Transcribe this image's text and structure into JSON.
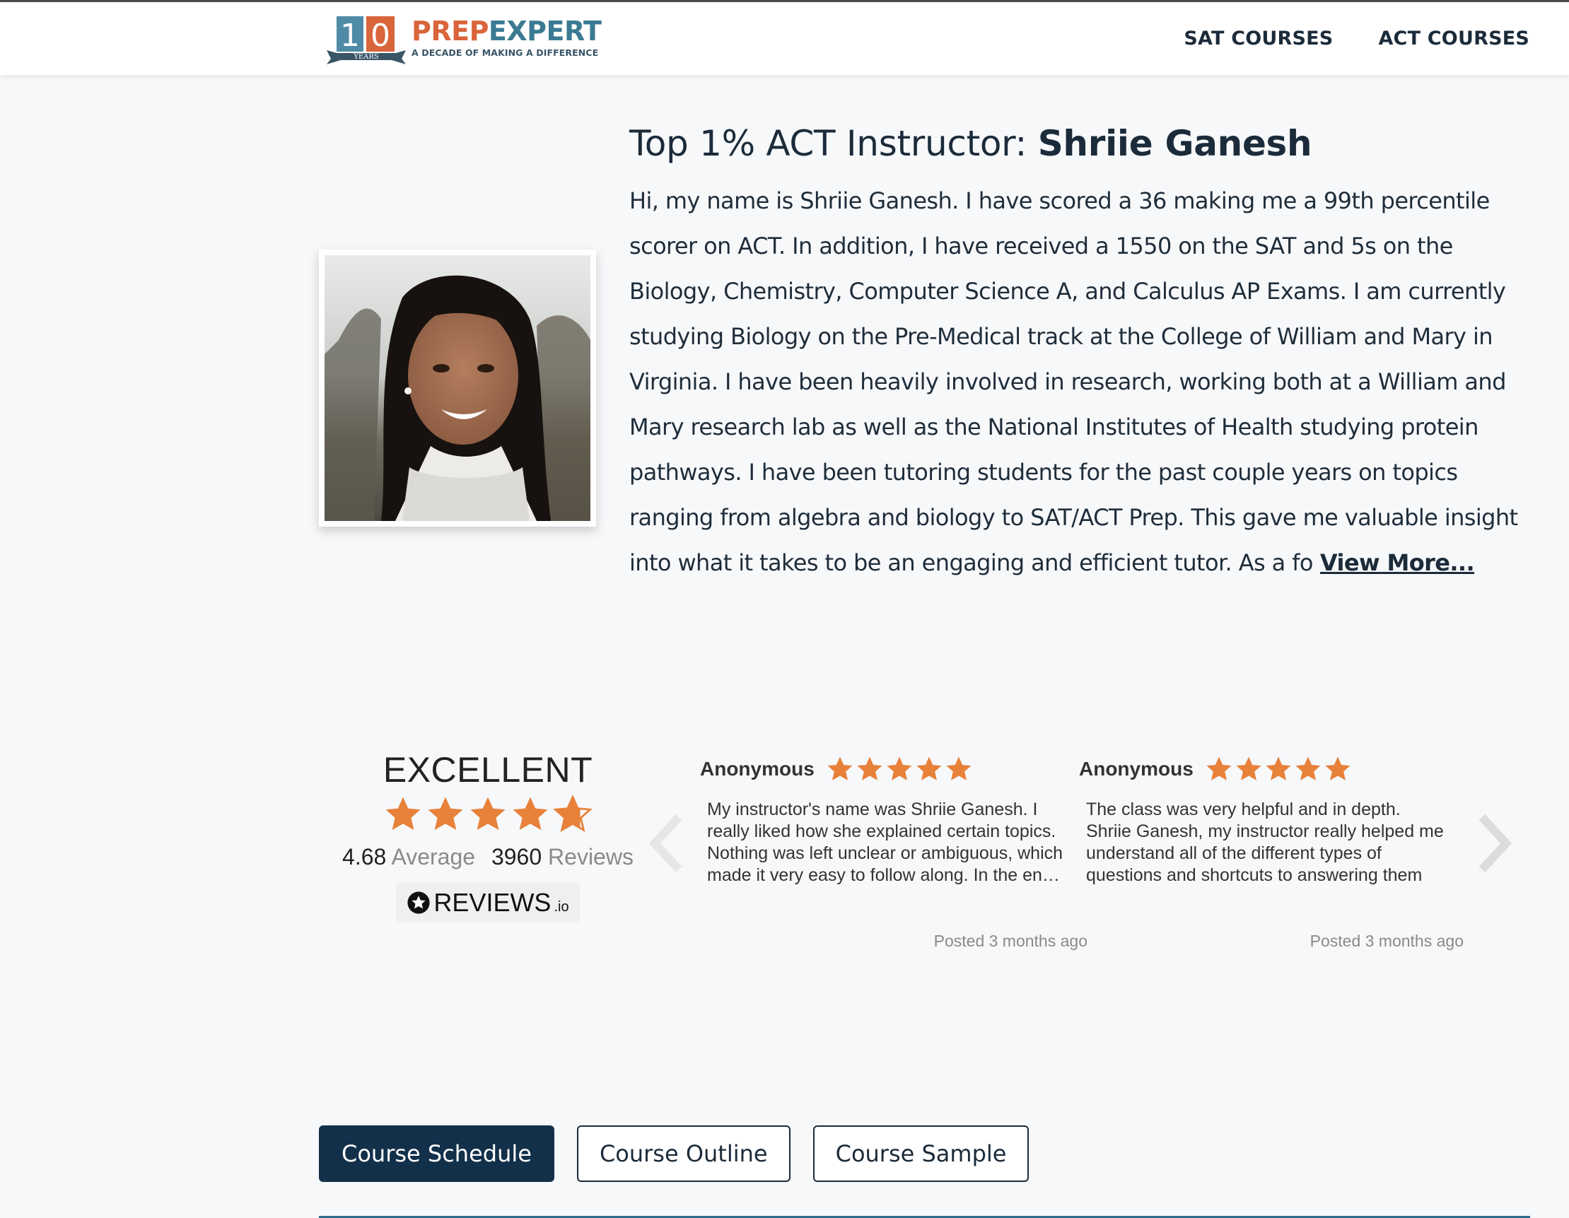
{
  "header": {
    "logo": {
      "badge_number": "10",
      "badge_label": "YEARS",
      "brand_prep": "PREP",
      "brand_expert": "EXPERT",
      "tagline": "A DECADE OF MAKING A DIFFERENCE"
    },
    "nav": [
      {
        "label": "SAT COURSES"
      },
      {
        "label": "ACT COURSES"
      }
    ]
  },
  "instructor": {
    "title_prefix": "Top 1% ACT Instructor: ",
    "name": "Shriie Ganesh",
    "bio": "Hi, my name is Shriie Ganesh. I have scored a 36 making me a 99th percentile scorer on ACT. In addition, I have received a 1550 on the SAT and 5s on the Biology, Chemistry, Computer Science A, and Calculus AP Exams. I am currently studying Biology on the Pre-Medical track at the College of William and Mary in Virginia. I have been heavily involved in research, working both at a William and Mary research lab as well as the National Institutes of Health studying protein pathways. I have been tutoring students for the past couple years on topics ranging from algebra and biology to SAT/ACT Prep. This gave me valuable insight into what it takes to be an engaging and efficient tutor. As a fo",
    "view_more": "View More..."
  },
  "reviews_widget": {
    "rating_word": "EXCELLENT",
    "average": "4.68",
    "average_label": "Average",
    "review_count": "3960",
    "reviews_label": "Reviews",
    "star_rating": 4.68,
    "provider": "REVIEWS",
    "provider_suffix": ".io",
    "star_color": "#e8813a",
    "reviews": [
      {
        "author": "Anonymous",
        "stars": 5,
        "text": "My instructor's name was Shriie Ganesh. I really liked how she explained certain topics. Nothing was left unclear or ambiguous, which made it very easy to follow along. In the end she answered all of our questions",
        "posted": "Posted 3 months ago"
      },
      {
        "author": "Anonymous",
        "stars": 5,
        "text": "The class was very helpful and in depth. Shriie Ganesh, my instructor really helped me understand all of the different types of questions and shortcuts to answering them",
        "posted": "Posted 3 months ago"
      }
    ]
  },
  "tabs": [
    {
      "label": "Course Schedule",
      "active": true
    },
    {
      "label": "Course Outline",
      "active": false
    },
    {
      "label": "Course Sample",
      "active": false
    }
  ],
  "colors": {
    "navy": "#13304a",
    "brand_orange": "#d9653b",
    "brand_teal": "#3c7a93",
    "background": "#f7f8fa"
  }
}
